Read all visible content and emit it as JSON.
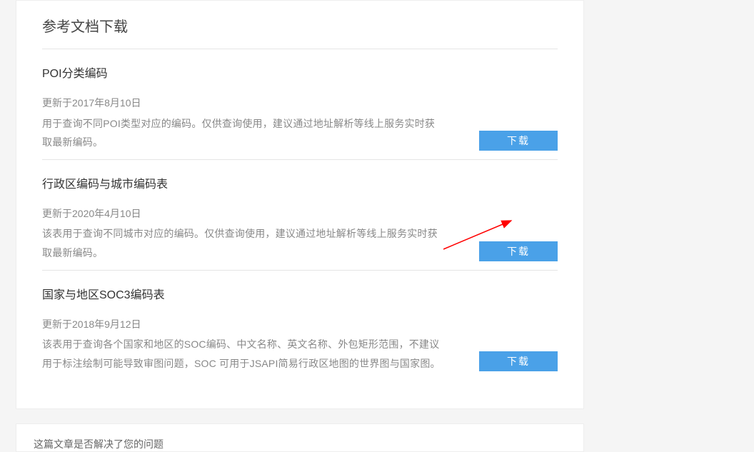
{
  "section": {
    "title": "参考文档下载",
    "items": [
      {
        "title": "POI分类编码",
        "meta": "更新于2017年8月10日",
        "desc": "用于查询不同POI类型对应的编码。仅供查询使用，建议通过地址解析等线上服务实时获取最新编码。",
        "button": "下载"
      },
      {
        "title": "行政区编码与城市编码表",
        "meta": "更新于2020年4月10日",
        "desc": "该表用于查询不同城市对应的编码。仅供查询使用，建议通过地址解析等线上服务实时获取最新编码。",
        "button": "下载"
      },
      {
        "title": "国家与地区SOC3编码表",
        "meta": "更新于2018年9月12日",
        "desc": "该表用于查询各个国家和地区的SOC编码、中文名称、英文名称、外包矩形范围，不建议用于标注绘制可能导致审图问题，SOC 可用于JSAPI简易行政区地图的世界图与国家图。",
        "button": "下载"
      }
    ]
  },
  "footer": {
    "question": "这篇文章是否解决了您的问题"
  }
}
